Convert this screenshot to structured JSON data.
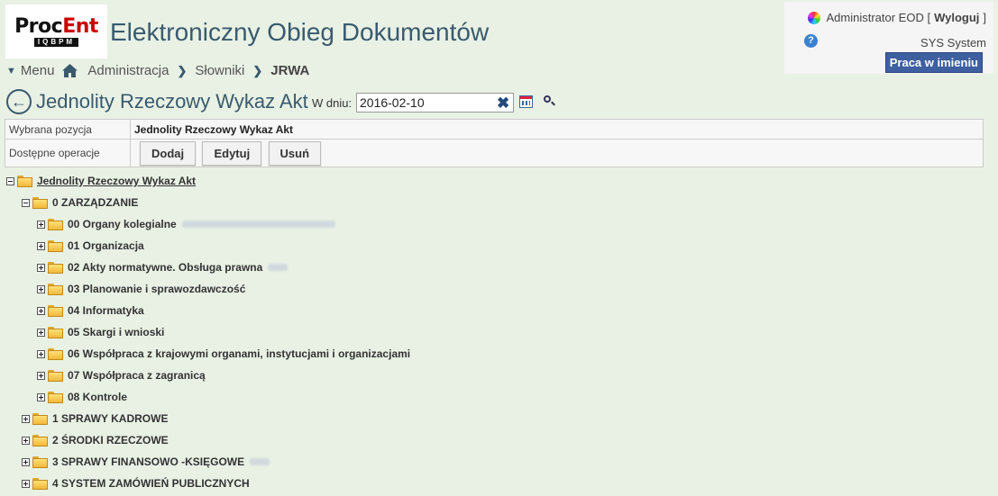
{
  "logo": {
    "brand_main": "Proc",
    "brand_accent": "Ent",
    "sub": "IQBPM"
  },
  "app_title": "Elektroniczny Obieg Dokumentów",
  "breadcrumb": {
    "menu": "Menu",
    "items": [
      "Administracja",
      "Słowniki"
    ],
    "current": "JRWA"
  },
  "user": {
    "name": "Administrator EOD [",
    "logout": "Wyloguj",
    "close_bracket": "]",
    "system": "SYS System",
    "impersonate": "Praca w imieniu"
  },
  "page": {
    "title": "Jednolity Rzeczowy Wykaz Akt",
    "date_label": "W dniu:",
    "date_value": "2016-02-10"
  },
  "info": {
    "selected_label": "Wybrana pozycja",
    "selected_value": "Jednolity Rzeczowy Wykaz Akt",
    "ops_label": "Dostępne operacje",
    "buttons": [
      "Dodaj",
      "Edytuj",
      "Usuń"
    ]
  },
  "tree": {
    "root": "Jednolity Rzeczowy Wykaz Akt",
    "level1_open": "0 ZARZĄDZANIE",
    "children": [
      "00 Organy kolegialne",
      "01 Organizacja",
      "02 Akty normatywne. Obsługa prawna",
      "03 Planowanie i sprawozdawczość",
      "04 Informatyka",
      "05 Skargi i wnioski",
      "06 Współpraca z krajowymi organami, instytucjami i organizacjami",
      "07 Współpraca z zagranicą",
      "08 Kontrole"
    ],
    "level1_closed": [
      "1 SPRAWY KADROWE",
      "2 ŚRODKI RZECZOWE",
      "3 SPRAWY FINANSOWO -KSIĘGOWE",
      "4 SYSTEM ZAMÓWIEŃ PUBLICZNYCH"
    ]
  },
  "colors": {
    "background": "#e8f1e4",
    "title": "#3a5a6e",
    "impersonate_button": "#3e5fa0"
  }
}
